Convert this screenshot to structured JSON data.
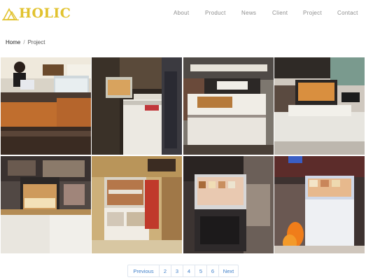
{
  "brand": {
    "name": "HOLIC",
    "logo_icon": "holic-logo-icon",
    "accent": "#e1c22e"
  },
  "nav": {
    "items": [
      {
        "label": "About"
      },
      {
        "label": "Product"
      },
      {
        "label": "News"
      },
      {
        "label": "Client"
      },
      {
        "label": "Project"
      },
      {
        "label": "Contact"
      }
    ]
  },
  "breadcrumb": {
    "home": "Home",
    "separator": "/",
    "current": "Project"
  },
  "gallery": {
    "items": [
      {
        "subject": "gelato-shop-counter-with-staff"
      },
      {
        "subject": "corner-display-counter"
      },
      {
        "subject": "curved-counter-shop"
      },
      {
        "subject": "display-case-showroom"
      },
      {
        "subject": "ice-cream-display-cabinet"
      },
      {
        "subject": "cake-showcase-cabinet"
      },
      {
        "subject": "gelato-freezer-cabinet"
      },
      {
        "subject": "blue-lit-display-freezer"
      }
    ]
  },
  "pagination": {
    "previous": "Previous",
    "pages": [
      "2",
      "3",
      "4",
      "5",
      "6"
    ],
    "next": "Next",
    "link_color": "#3f7fc9"
  }
}
